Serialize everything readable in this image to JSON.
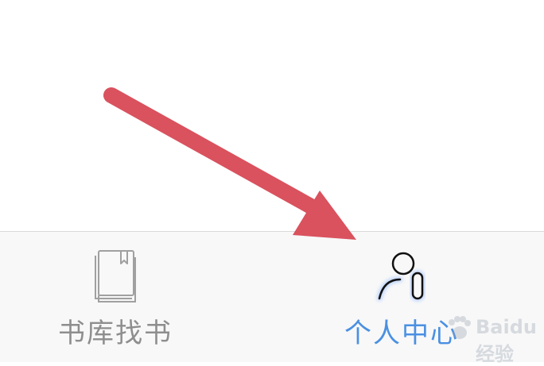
{
  "tab_bar": {
    "tabs": [
      {
        "label": "书库找书",
        "icon": "book-icon",
        "selected": false
      },
      {
        "label": "个人中心",
        "icon": "user-icon",
        "selected": true
      }
    ]
  },
  "colors": {
    "active_tab": "#4a90e2",
    "inactive_tab": "#8e8e8e",
    "tab_bar_background": "#f8f8f8",
    "annotation_arrow": "#d9525e"
  },
  "annotation": {
    "type": "arrow",
    "points_to": "tab-profile"
  },
  "watermark": {
    "text": "Baidu经验"
  }
}
